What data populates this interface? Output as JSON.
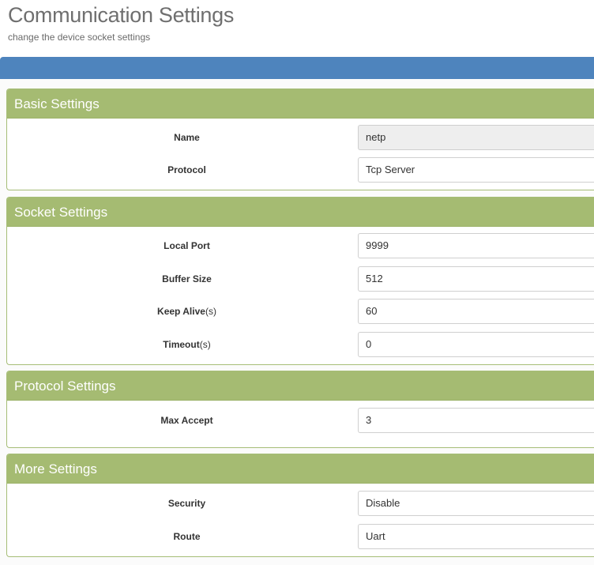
{
  "header": {
    "title": "Communication Settings",
    "subtitle": "change the device socket settings"
  },
  "colors": {
    "accent_bar": "#4e84bd",
    "panel_heading": "#a5bb72"
  },
  "basic": {
    "heading": "Basic Settings",
    "name_label": "Name",
    "name_value": "netp",
    "protocol_label": "Protocol",
    "protocol_value": "Tcp Server"
  },
  "socket": {
    "heading": "Socket Settings",
    "local_port_label": "Local Port",
    "local_port_value": "9999",
    "buffer_size_label": "Buffer Size",
    "buffer_size_value": "512",
    "keep_alive_label": "Keep Alive",
    "keep_alive_unit": "(s)",
    "keep_alive_value": "60",
    "timeout_label": "Timeout",
    "timeout_unit": "(s)",
    "timeout_value": "0"
  },
  "protocol": {
    "heading": "Protocol Settings",
    "max_accept_label": "Max Accept",
    "max_accept_value": "3"
  },
  "more": {
    "heading": "More Settings",
    "security_label": "Security",
    "security_value": "Disable",
    "route_label": "Route",
    "route_value": "Uart"
  }
}
